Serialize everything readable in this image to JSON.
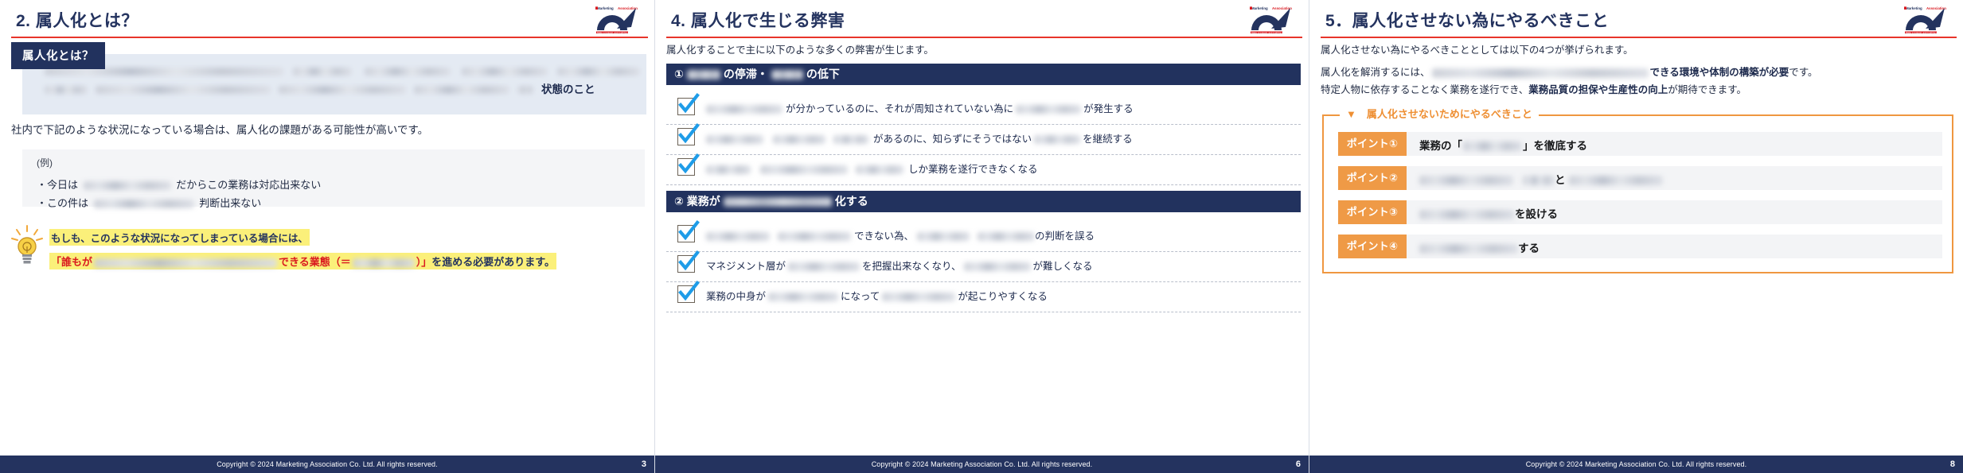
{
  "deck": {
    "footer_copyright": "Copyright © 2024 Marketing Association Co. Ltd. All rights reserved.",
    "logo_alt": "Marketing Association",
    "colors": {
      "navy": "#22325e",
      "red_rule": "#e8342a",
      "orange": "#ef9a46",
      "highlight_yellow": "#fbf07a",
      "panel_blue": "#e4eaf3",
      "panel_gray": "#f4f5f7"
    }
  },
  "slides": [
    {
      "id": "slide-2",
      "title": "2. 属人化とは？",
      "page_number": "3",
      "tag_label": "属人化とは？",
      "definition_tail": "状態のこと",
      "note": "社内で下記のような状況になっている場合は、属人化の課題がある可能性が高いです。",
      "example_label": "(例)",
      "bullets": [
        {
          "prefix": "・今日は",
          "suffix": "だからこの業務は対応出来ない"
        },
        {
          "prefix": "・この件は",
          "suffix": "判断出来ない"
        }
      ],
      "tip": {
        "line1": "もしも、このような状況になってしまっている場合には、",
        "line2_open": "「誰もが",
        "line2_mid": "できる業態（＝",
        "line2_close": "）」",
        "line2_tail": "を進める必要があります。"
      }
    },
    {
      "id": "slide-4",
      "title": "4. 属人化で生じる弊害",
      "page_number": "6",
      "lead": "属人化することで主に以下のような多くの弊害が生じます。",
      "sections": [
        {
          "heading_pre": "①",
          "heading_mid": "の停滞・",
          "heading_post": "の低下",
          "items": [
            {
              "mid": "が分かっているのに、それが周知されていない為に",
              "tail": "が発生する"
            },
            {
              "mid": "があるのに、知らずにそうではない",
              "tail": "を継続する"
            },
            {
              "mid": "しか業務を遂行できなくなる",
              "tail": ""
            }
          ]
        },
        {
          "heading_pre": "② 業務が",
          "heading_mid": "",
          "heading_post": "化する",
          "items": [
            {
              "mid": "できない為、",
              "tail": "の判断を誤る"
            },
            {
              "lead": "マネジメント層が",
              "mid": "を把握出来なくなり、",
              "tail": "が難しくなる"
            },
            {
              "lead": "業務の中身が",
              "mid": "になって",
              "tail": "が起こりやすくなる"
            }
          ]
        }
      ]
    },
    {
      "id": "slide-5",
      "title": "5．属人化させない為にやるべきこと",
      "page_number": "8",
      "lead": "属人化させない為にやるべきこととしては以下の4つが挙げられます。",
      "para1_pre": "属人化を解消するには、",
      "para1_bold": "できる環境や体制の構築が必要",
      "para1_tail": "です。",
      "para2_pre": "特定人物に依存することなく業務を遂行でき、",
      "para2_bold": "業務品質の担保や生産性の向上",
      "para2_tail": "が期待できます。",
      "box_legend": "▼　属人化させないためにやるべきこと",
      "points": [
        {
          "badge": "ポイント①",
          "pre": "業務の「",
          "post": "」を徹底する"
        },
        {
          "badge": "ポイント②",
          "pre": "",
          "post": "と"
        },
        {
          "badge": "ポイント③",
          "pre": "",
          "post": "を設ける"
        },
        {
          "badge": "ポイント④",
          "pre": "",
          "post": "する"
        }
      ]
    }
  ]
}
